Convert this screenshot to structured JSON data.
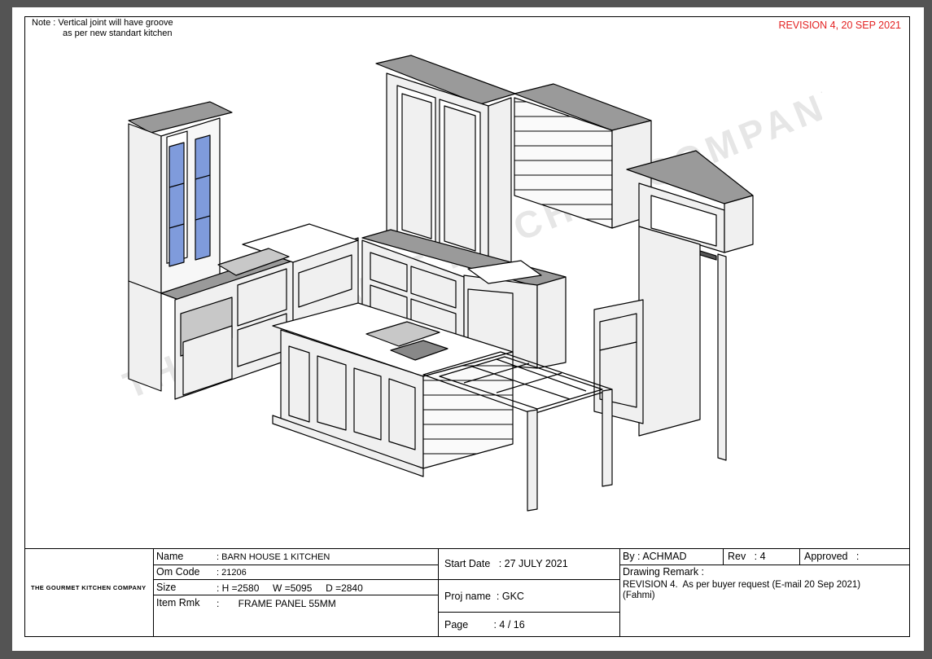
{
  "note": {
    "line1": "Note : Vertical joint will have groove",
    "line2": "as per new standart kitchen"
  },
  "revision": "REVISION 4, 20 SEP 2021",
  "watermark": "THE GOURMET KITCHEN COMPANY",
  "colors": {
    "revision": "#e32222",
    "glass": "#7f9bdc",
    "panel": "#f0f0f0",
    "top_shade": "#9a9a9a"
  },
  "title_block": {
    "company": "THE GOURMET KITCHEN COMPANY",
    "name_label": "Name",
    "name_value": ": BARN HOUSE 1 KITCHEN",
    "om_code_label": "Om Code",
    "om_code_value": ": 21206",
    "size_label": "Size",
    "size_value": ": H =2580     W =5095     D =2840",
    "item_rmk_label": "Item Rmk",
    "item_rmk_value": ":       FRAME PANEL 55MM",
    "start_date": "Start Date   : 27 JULY 2021",
    "proj_name": "Proj name  : GKC",
    "page": "Page         : 4 / 16",
    "by": "By : ACHMAD",
    "rev": "Rev   : 4",
    "approved": "Approved   :",
    "drawing_remark_label": "Drawing Remark :",
    "drawing_remark_text": "REVISION 4.  As per buyer request (E-mail 20 Sep 2021)",
    "drawing_remark_text2": "(Fahmi)"
  }
}
